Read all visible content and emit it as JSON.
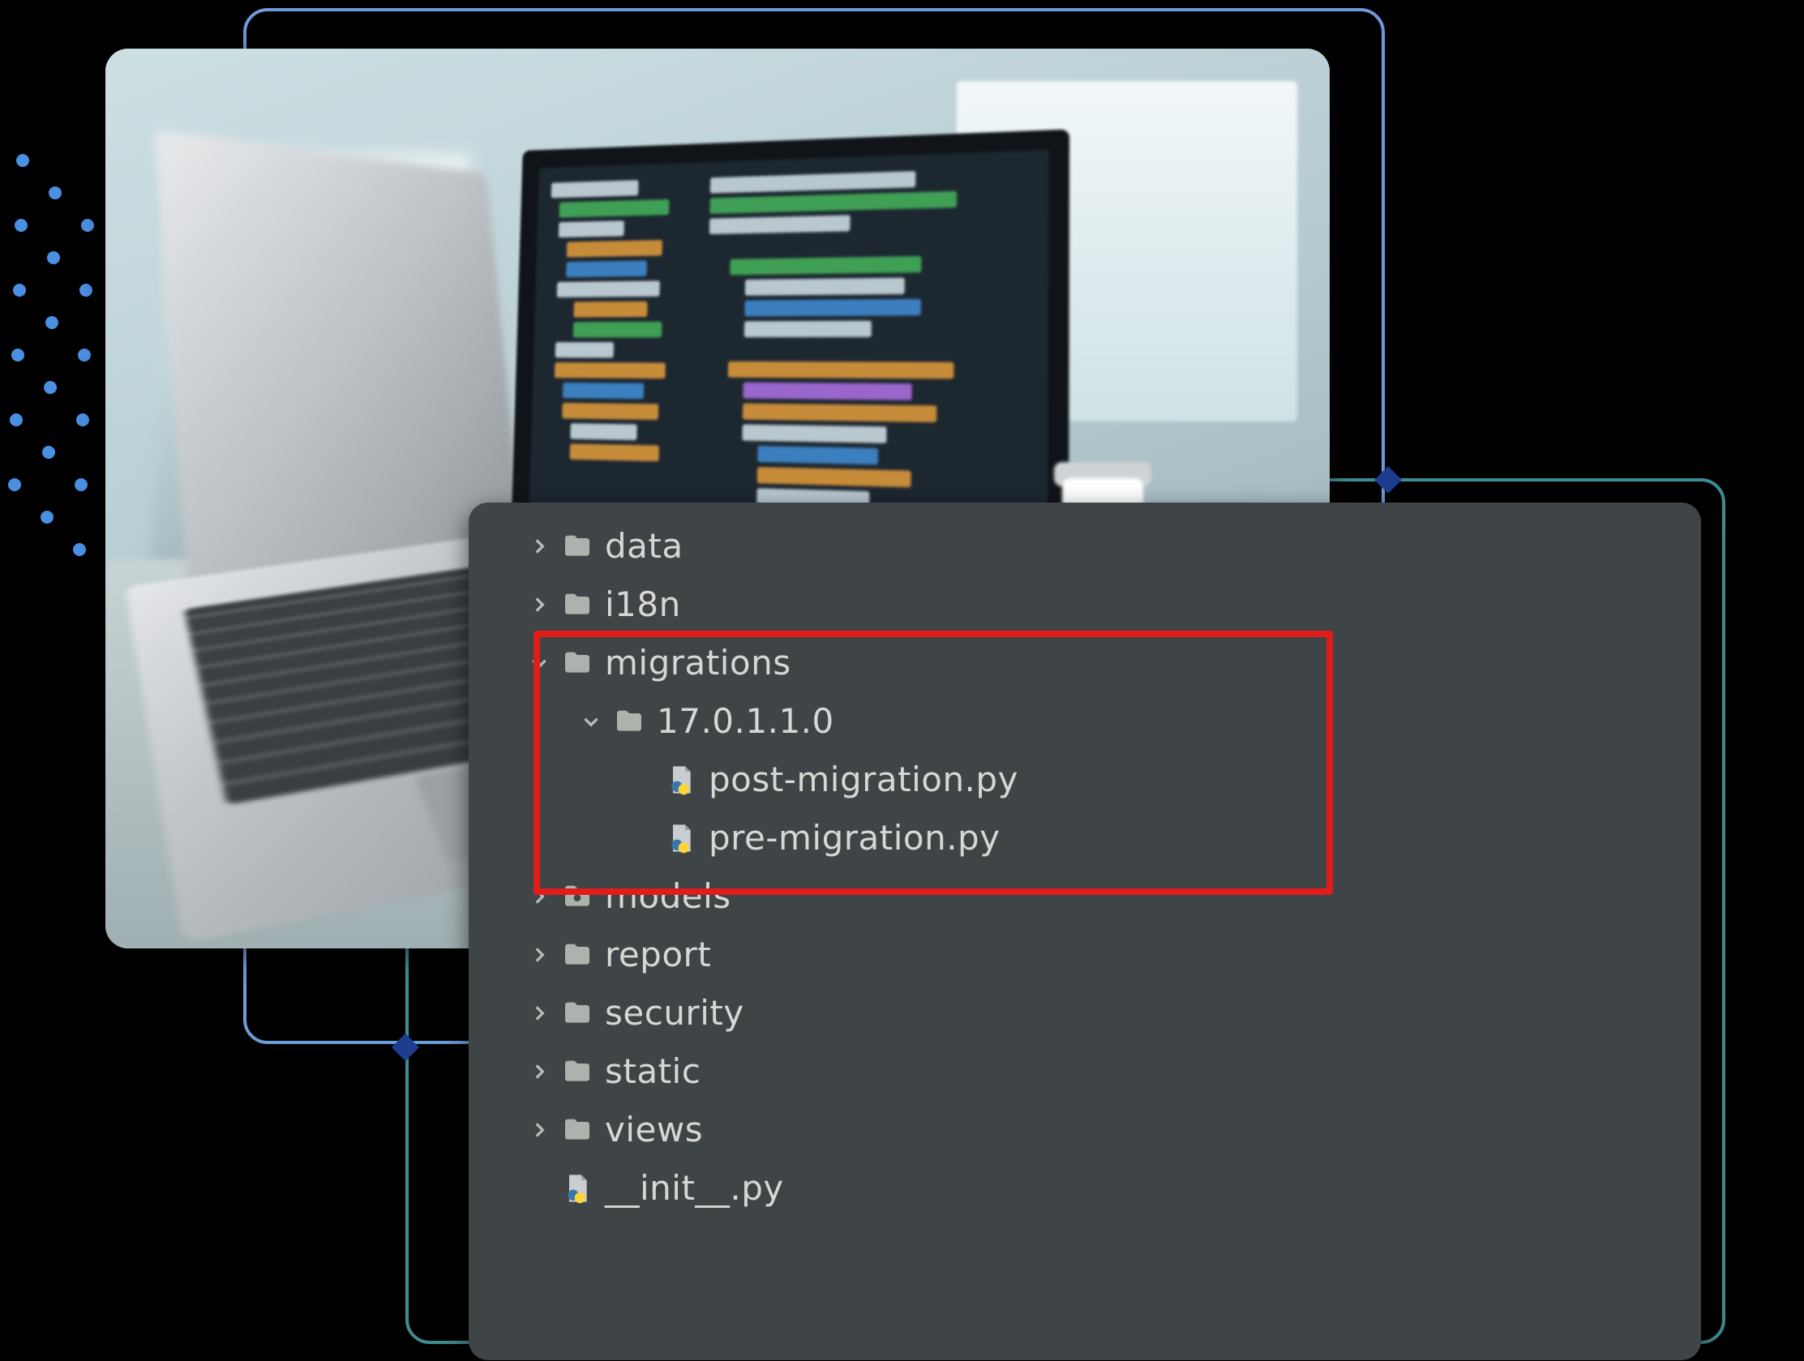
{
  "tree": {
    "items": [
      {
        "type": "folder",
        "label": "data",
        "expanded": false,
        "depth": 0
      },
      {
        "type": "folder",
        "label": "i18n",
        "expanded": false,
        "depth": 0
      },
      {
        "type": "folder",
        "label": "migrations",
        "expanded": true,
        "depth": 0
      },
      {
        "type": "folder",
        "label": "17.0.1.1.0",
        "expanded": true,
        "depth": 1
      },
      {
        "type": "pyfile",
        "label": "post-migration.py",
        "depth": 2
      },
      {
        "type": "pyfile",
        "label": "pre-migration.py",
        "depth": 2
      },
      {
        "type": "folder-dot",
        "label": "models",
        "expanded": false,
        "depth": 0
      },
      {
        "type": "folder",
        "label": "report",
        "expanded": false,
        "depth": 0
      },
      {
        "type": "folder",
        "label": "security",
        "expanded": false,
        "depth": 0
      },
      {
        "type": "folder",
        "label": "static",
        "expanded": false,
        "depth": 0
      },
      {
        "type": "folder",
        "label": "views",
        "expanded": false,
        "depth": 0
      },
      {
        "type": "pyfile",
        "label": "__init__.py",
        "depth": 0
      }
    ]
  },
  "icons": {
    "folder": "folder-icon",
    "folder-dot": "folder-dot-icon",
    "pyfile": "python-file-icon",
    "chev_right": "chevron-right-icon",
    "chev_down": "chevron-down-icon"
  }
}
